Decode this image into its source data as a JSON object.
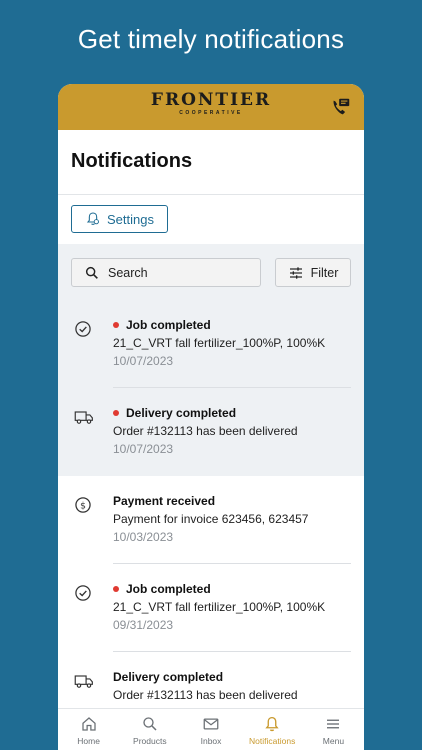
{
  "promo": {
    "headline": "Get timely notifications"
  },
  "app": {
    "logo_main": "FRONTIER",
    "logo_sub": "COOPERATIVE",
    "page_title": "Notifications",
    "settings_label": "Settings",
    "search_label": "Search",
    "filter_label": "Filter"
  },
  "colors": {
    "brand_gold": "#c99a2e",
    "brand_blue": "#1f6c93",
    "unread_dot": "#e03a31"
  },
  "notifications": [
    {
      "icon": "check-circle-icon",
      "unread": true,
      "title": "Job completed",
      "body": "21_C_VRT fall fertilizer_100%P, 100%K",
      "date": "10/07/2023"
    },
    {
      "icon": "truck-icon",
      "unread": true,
      "title": "Delivery completed",
      "body": "Order #132113 has been delivered",
      "date": "10/07/2023"
    },
    {
      "icon": "dollar-circle-icon",
      "unread": false,
      "title": "Payment received",
      "body": "Payment for invoice 623456, 623457",
      "date": "10/03/2023"
    },
    {
      "icon": "check-circle-icon",
      "unread": true,
      "title": "Job completed",
      "body": "21_C_VRT fall fertilizer_100%P, 100%K",
      "date": "09/31/2023"
    },
    {
      "icon": "truck-icon",
      "unread": false,
      "title": "Delivery completed",
      "body": "Order #132113 has been delivered",
      "date": ""
    }
  ],
  "nav": [
    {
      "label": "Home",
      "icon": "home-icon",
      "active": false
    },
    {
      "label": "Products",
      "icon": "search-icon",
      "active": false
    },
    {
      "label": "Inbox",
      "icon": "mail-icon",
      "active": false
    },
    {
      "label": "Notifications",
      "icon": "bell-icon",
      "active": true
    },
    {
      "label": "Menu",
      "icon": "menu-icon",
      "active": false
    }
  ]
}
